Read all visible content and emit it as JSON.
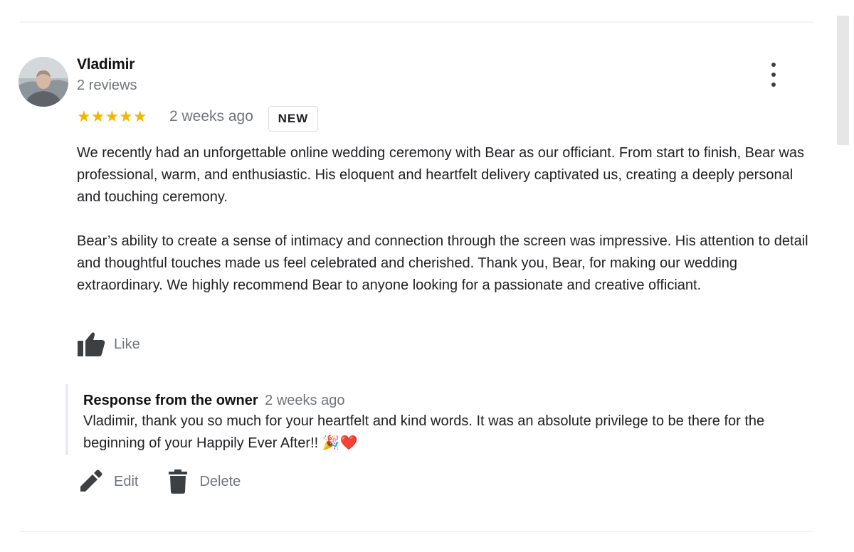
{
  "review": {
    "author": "Vladimir",
    "reviews_count": "2 reviews",
    "stars": "★★★★★",
    "rating": 5,
    "time": "2 weeks ago",
    "badge": "NEW",
    "paragraphs": [
      "We recently had an unforgettable online wedding ceremony with Bear as our officiant. From start to finish, Bear was professional, warm, and enthusiastic. His eloquent and heartfelt delivery captivated us, creating a deeply personal and touching ceremony.",
      "Bear’s ability to create a sense of intimacy and connection through the screen was impressive. His attention to detail and thoughtful touches made us feel celebrated and cherished. Thank you, Bear, for making our wedding extraordinary. We highly recommend Bear to anyone looking for a passionate and creative officiant."
    ],
    "like_label": "Like"
  },
  "response": {
    "title": "Response from the owner",
    "time": "2 weeks ago",
    "text": "Vladimir, thank you so much for your heartfelt and kind words. It was an absolute privilege to be there for the beginning of your Happily Ever After!! 🎉❤️"
  },
  "actions": {
    "edit_label": "Edit",
    "delete_label": "Delete"
  },
  "colors": {
    "star": "#f4b400",
    "muted_text": "#70757a",
    "icon": "#3c4043"
  },
  "icons": [
    "more-vert-icon",
    "thumb-up-icon",
    "pencil-icon",
    "trash-icon"
  ]
}
